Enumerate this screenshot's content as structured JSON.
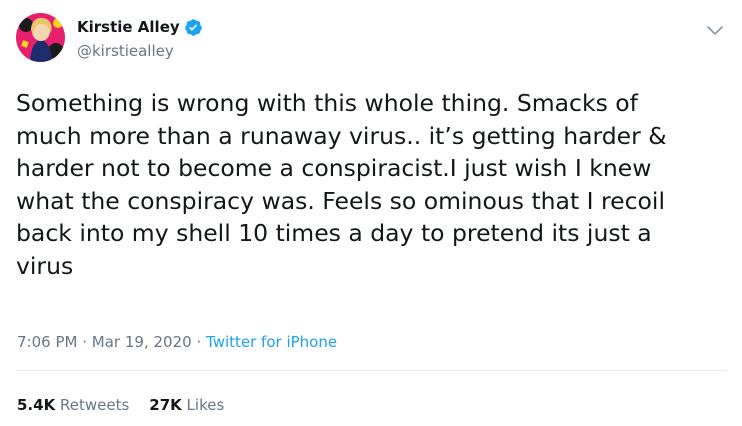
{
  "author": {
    "display_name": "Kirstie Alley",
    "handle": "@kirstiealley",
    "verified": true,
    "avatar_icon": "avatar-portrait"
  },
  "tweet": {
    "text": "Something is wrong with this whole thing. Smacks of\nmuch more than a runaway virus.. it’s getting harder &\nharder not to become a conspiracist.I just wish I knew\nwhat the conspiracy was. Feels so ominous that I recoil\nback into my shell 10 times a day to pretend its just a\nvirus",
    "time": "7:06 PM",
    "separator": "·",
    "date": "Mar 19, 2020",
    "source": "Twitter for iPhone"
  },
  "stats": {
    "retweets_count": "5.4K",
    "retweets_label": "Retweets",
    "likes_count": "27K",
    "likes_label": "Likes"
  },
  "colors": {
    "text": "#14171a",
    "secondary": "#657786",
    "accent": "#1da1f2",
    "divider": "#e6ecf0"
  },
  "icons": {
    "verified": "verified-badge-icon",
    "menu": "chevron-down-icon"
  }
}
